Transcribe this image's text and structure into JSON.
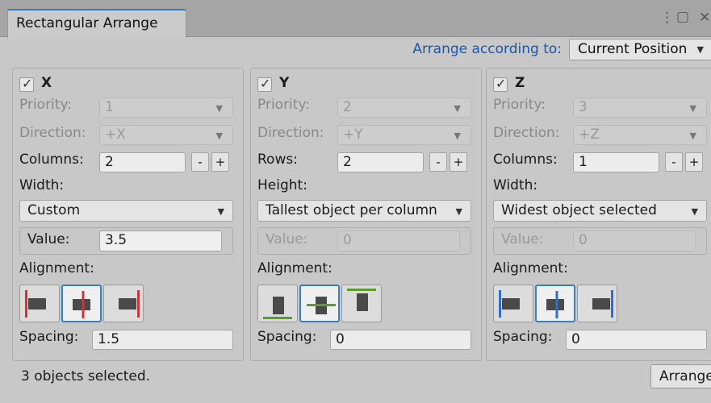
{
  "window": {
    "tab_title": "Rectangular Arrange",
    "menu_glyph": "⋮",
    "maximize_glyph": "▢",
    "close_glyph": "✕"
  },
  "header": {
    "arrange_label": "Arrange according to:",
    "arrange_value": "Current Position"
  },
  "panels": {
    "x": {
      "axis": "X",
      "enabled": true,
      "priority_label": "Priority:",
      "priority_value": "1",
      "direction_label": "Direction:",
      "direction_value": "+X",
      "count_label": "Columns:",
      "count_value": "2",
      "size_label": "Width:",
      "size_mode": "Custom",
      "value_label": "Value:",
      "value": "3.5",
      "value_enabled": true,
      "alignment_label": "Alignment:",
      "alignment_options": [
        "min-icon",
        "center-icon",
        "max-icon"
      ],
      "alignment_selected": "center",
      "spacing_label": "Spacing:",
      "spacing_value": "1.5",
      "accent_color": "#d0343a"
    },
    "y": {
      "axis": "Y",
      "enabled": true,
      "priority_label": "Priority:",
      "priority_value": "2",
      "direction_label": "Direction:",
      "direction_value": "+Y",
      "count_label": "Rows:",
      "count_value": "2",
      "size_label": "Height:",
      "size_mode": "Tallest object per column",
      "value_label": "Value:",
      "value": "0",
      "value_enabled": false,
      "alignment_label": "Alignment:",
      "alignment_options": [
        "min-icon",
        "center-icon",
        "max-icon"
      ],
      "alignment_selected": "center",
      "spacing_label": "Spacing:",
      "spacing_value": "0",
      "accent_color": "#5c9c2c"
    },
    "z": {
      "axis": "Z",
      "enabled": true,
      "priority_label": "Priority:",
      "priority_value": "3",
      "direction_label": "Direction:",
      "direction_value": "+Z",
      "count_label": "Columns:",
      "count_value": "1",
      "size_label": "Width:",
      "size_mode": "Widest object selected",
      "value_label": "Value:",
      "value": "0",
      "value_enabled": false,
      "alignment_label": "Alignment:",
      "alignment_options": [
        "min-icon",
        "center-icon",
        "max-icon"
      ],
      "alignment_selected": "center",
      "spacing_label": "Spacing:",
      "spacing_value": "0",
      "accent_color": "#2d6fcc"
    }
  },
  "stepper": {
    "minus": "-",
    "plus": "+"
  },
  "footer": {
    "status": "3 objects selected.",
    "arrange_button": "Arrange"
  },
  "check_glyph": "✓",
  "caret_glyph": "▼"
}
